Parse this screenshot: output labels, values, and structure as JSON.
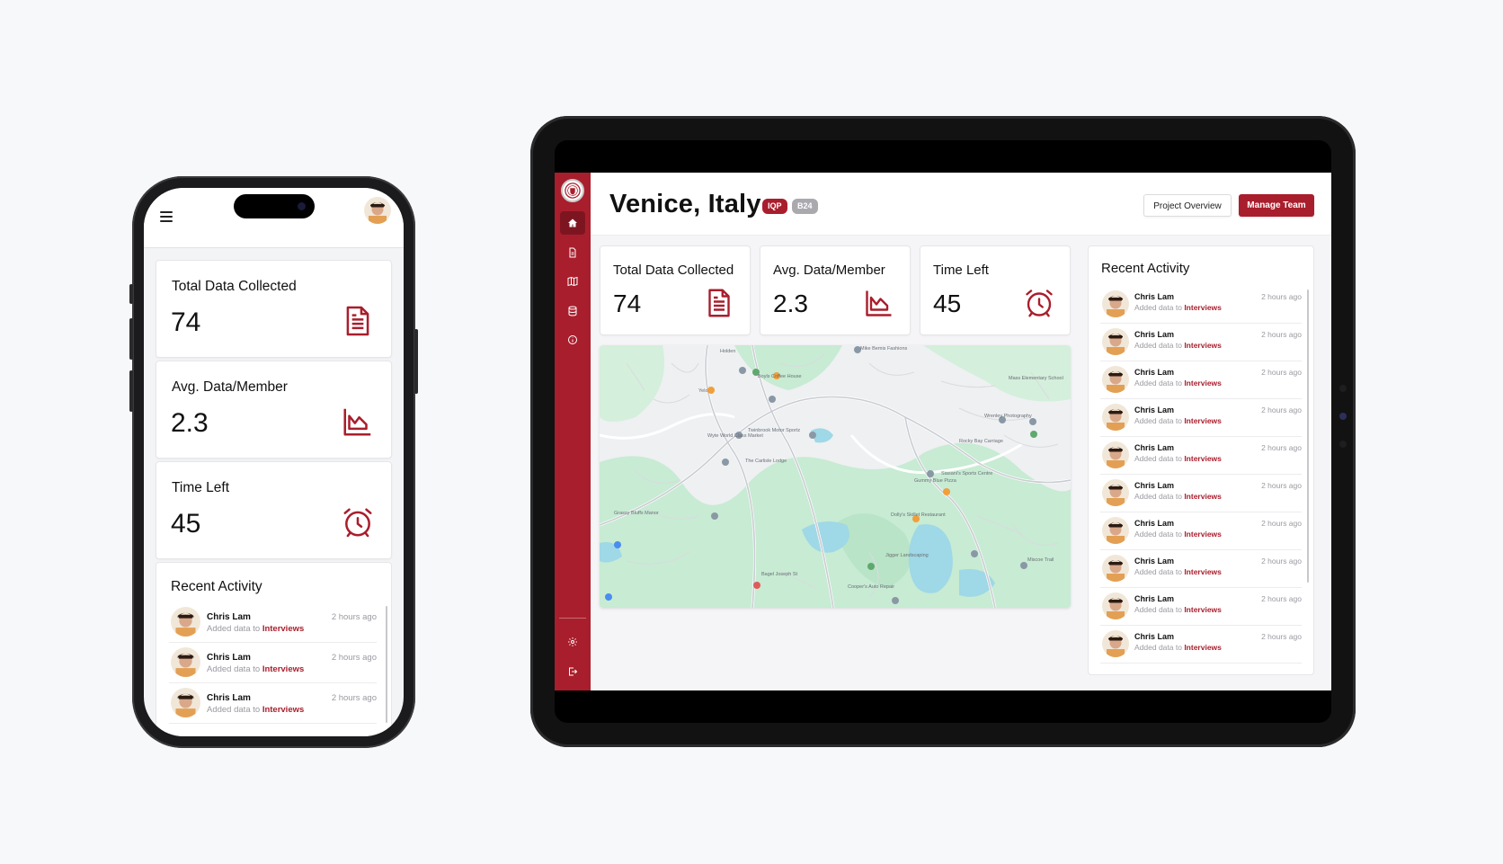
{
  "colors": {
    "brand": "#a91e2c",
    "brand_dark": "#7d1520",
    "badge_grey": "#a9a9ae",
    "map_green": "#c7ebd3",
    "map_water": "#9fd8e6"
  },
  "stats": [
    {
      "label": "Total Data Collected",
      "value": "74",
      "icon": "document-icon"
    },
    {
      "label": "Avg. Data/Member",
      "value": "2.3",
      "icon": "area-chart-icon"
    },
    {
      "label": "Time Left",
      "value": "45",
      "icon": "alarm-clock-icon"
    }
  ],
  "activity": {
    "title": "Recent Activity",
    "items": [
      {
        "name": "Chris Lam",
        "prefix": "Added data to",
        "target": "Interviews",
        "time": "2 hours ago"
      },
      {
        "name": "Chris Lam",
        "prefix": "Added data to",
        "target": "Interviews",
        "time": "2 hours ago"
      },
      {
        "name": "Chris Lam",
        "prefix": "Added data to",
        "target": "Interviews",
        "time": "2 hours ago"
      },
      {
        "name": "Chris Lam",
        "prefix": "Added data to",
        "target": "Interviews",
        "time": "2 hours ago"
      },
      {
        "name": "Chris Lam",
        "prefix": "Added data to",
        "target": "Interviews",
        "time": "2 hours ago"
      },
      {
        "name": "Chris Lam",
        "prefix": "Added data to",
        "target": "Interviews",
        "time": "2 hours ago"
      },
      {
        "name": "Chris Lam",
        "prefix": "Added data to",
        "target": "Interviews",
        "time": "2 hours ago"
      },
      {
        "name": "Chris Lam",
        "prefix": "Added data to",
        "target": "Interviews",
        "time": "2 hours ago"
      },
      {
        "name": "Chris Lam",
        "prefix": "Added data to",
        "target": "Interviews",
        "time": "2 hours ago"
      },
      {
        "name": "Chris Lam",
        "prefix": "Added data to",
        "target": "Interviews",
        "time": "2 hours ago"
      }
    ]
  },
  "tablet": {
    "title": "Venice, Italy",
    "badges": [
      "IQP",
      "B24"
    ],
    "buttons": {
      "overview": "Project Overview",
      "manage": "Manage Team"
    },
    "nav": [
      "home-icon",
      "file-icon",
      "map-icon",
      "database-icon",
      "info-icon"
    ],
    "nav_bottom": [
      "settings-icon",
      "logout-icon"
    ]
  },
  "map": {
    "labels": [
      "Holden",
      "Boyls Coffee House",
      "Yelo",
      "Wyte World Class Market",
      "Twinbrook Motor Sportz",
      "The Carlisle Lodge",
      "Mike Bemis Fashions",
      "Mass Elementary School",
      "Siasani's Sports Centre",
      "Gummy Blue Pizza",
      "Dolly's Skillet Restaurant",
      "Bagel Joseph St",
      "Cooper's Auto Repair",
      "Jigger Landscaping",
      "Miscoe Trail",
      "Wrenley Photography",
      "Rocky Bay Carriage",
      "Grassy Bluffs Manor"
    ]
  }
}
